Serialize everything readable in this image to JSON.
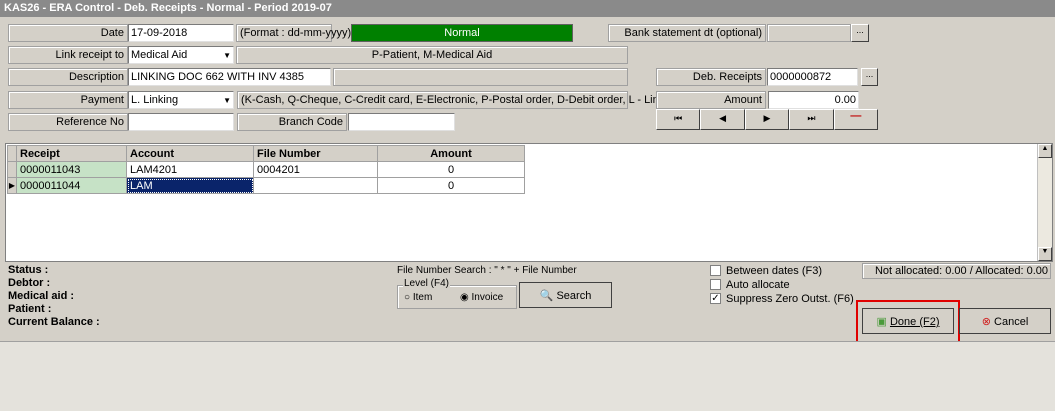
{
  "title": "KAS26 - ERA Control - Deb. Receipts - Normal -  Period 2019-07",
  "form": {
    "date_label": "Date",
    "date_value": "17-09-2018",
    "date_format": "(Format : dd-mm-yyyy)",
    "mode": "Normal",
    "mode_color": "#008000",
    "bank_label": "Bank statement dt (optional)",
    "bank_value": "",
    "ellipsis": "...",
    "link_label": "Link receipt to",
    "link_value": "Medical Aid",
    "link_hint": "P-Patient, M-Medical Aid",
    "desc_label": "Description",
    "desc_value": "LINKING DOC 662 WITH INV 4385",
    "deb_label": "Deb. Receipts",
    "deb_value": "0000000872",
    "payment_label": "Payment",
    "payment_value": "L. Linking",
    "payment_hint": "(K-Cash, Q-Cheque,  C-Credit card, E-Electronic, P-Postal order, D-Debit order, L - Linking)",
    "amount_label": "Amount",
    "amount_value": "0.00",
    "ref_label": "Reference No",
    "ref_value": "",
    "branch_label": "Branch Code",
    "branch_value": ""
  },
  "grid": {
    "columns": [
      "Receipt",
      "Account",
      "File Number",
      "Amount"
    ],
    "rows": [
      [
        "0000011043",
        "LAM4201",
        "0004201",
        "0"
      ],
      [
        "0000011044",
        "LAM",
        "",
        "0"
      ]
    ]
  },
  "info": {
    "status": "Status :",
    "debtor": "Debtor :",
    "medical_aid": "Medical aid :",
    "patient": "Patient :",
    "balance": "Current Balance :"
  },
  "search": {
    "hint": "File Number Search : \" * \" + File Number",
    "level": "Level (F4)",
    "item": "Item",
    "invoice": "Invoice",
    "button": "Search"
  },
  "options": {
    "between": "Between dates (F3)",
    "auto": "Auto allocate",
    "suppress": "Suppress Zero Outst. (F6)"
  },
  "allocation": "Not allocated: 0.00 / Allocated: 0.00",
  "done": "Done (F2)",
  "cancel": "Cancel"
}
